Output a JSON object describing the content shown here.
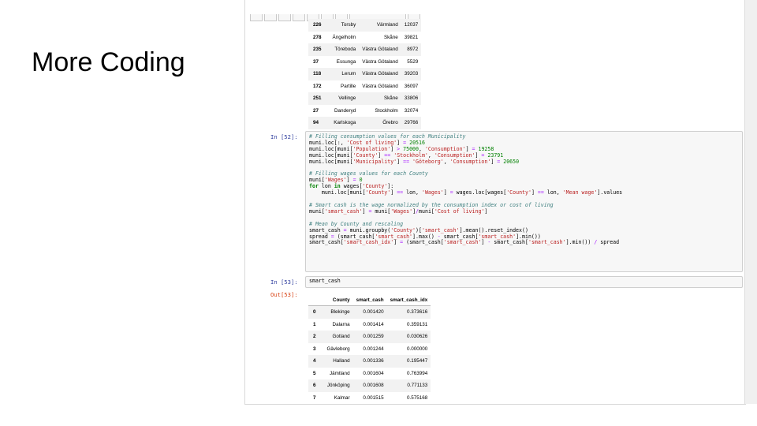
{
  "slide": {
    "title": "More Coding"
  },
  "table1": {
    "rows": [
      {
        "idx": "226",
        "municipality": "Torsby",
        "county": "Värmland",
        "value": "12037"
      },
      {
        "idx": "278",
        "municipality": "Ängelholm",
        "county": "Skåne",
        "value": "39821"
      },
      {
        "idx": "235",
        "municipality": "Töreboda",
        "county": "Västra Götaland",
        "value": "8972"
      },
      {
        "idx": "37",
        "municipality": "Essunga",
        "county": "Västra Götaland",
        "value": "5529"
      },
      {
        "idx": "118",
        "municipality": "Lerum",
        "county": "Västra Götaland",
        "value": "39203"
      },
      {
        "idx": "172",
        "municipality": "Partille",
        "county": "Västra Götaland",
        "value": "36097"
      },
      {
        "idx": "251",
        "municipality": "Vellinge",
        "county": "Skåne",
        "value": "33806"
      },
      {
        "idx": "27",
        "municipality": "Danderyd",
        "county": "Stockholm",
        "value": "32074"
      },
      {
        "idx": "94",
        "municipality": "Karlskoga",
        "county": "Örebro",
        "value": "29766"
      }
    ]
  },
  "cell52": {
    "prompt": "In [52]:",
    "lines": [
      [
        {
          "t": "# Filling consumption values for each Municipality",
          "c": "cm"
        }
      ],
      [
        {
          "t": "muni.loc[:, "
        },
        {
          "t": "'Cost of living'",
          "c": "st"
        },
        {
          "t": "] "
        },
        {
          "t": "=",
          "c": "op"
        },
        {
          "t": " "
        },
        {
          "t": "20516",
          "c": "nu"
        }
      ],
      [
        {
          "t": "muni.loc[muni["
        },
        {
          "t": "'Population'",
          "c": "st"
        },
        {
          "t": "] "
        },
        {
          "t": ">",
          "c": "op"
        },
        {
          "t": " "
        },
        {
          "t": "75000",
          "c": "nu"
        },
        {
          "t": ", "
        },
        {
          "t": "'Consumption'",
          "c": "st"
        },
        {
          "t": "] "
        },
        {
          "t": "=",
          "c": "op"
        },
        {
          "t": " "
        },
        {
          "t": "19258",
          "c": "nu"
        }
      ],
      [
        {
          "t": "muni.loc[muni["
        },
        {
          "t": "'County'",
          "c": "st"
        },
        {
          "t": "] "
        },
        {
          "t": "==",
          "c": "op"
        },
        {
          "t": " "
        },
        {
          "t": "'Stockholm'",
          "c": "st"
        },
        {
          "t": ", "
        },
        {
          "t": "'Consumption'",
          "c": "st"
        },
        {
          "t": "] "
        },
        {
          "t": "=",
          "c": "op"
        },
        {
          "t": " "
        },
        {
          "t": "23791",
          "c": "nu"
        }
      ],
      [
        {
          "t": "muni.loc[muni["
        },
        {
          "t": "'Municipality'",
          "c": "st"
        },
        {
          "t": "] "
        },
        {
          "t": "==",
          "c": "op"
        },
        {
          "t": " "
        },
        {
          "t": "'Göteborg'",
          "c": "st"
        },
        {
          "t": ", "
        },
        {
          "t": "'Consumption'",
          "c": "st"
        },
        {
          "t": "] "
        },
        {
          "t": "=",
          "c": "op"
        },
        {
          "t": " "
        },
        {
          "t": "20650",
          "c": "nu"
        }
      ],
      [],
      [
        {
          "t": "# Filling wages values for each County",
          "c": "cm"
        }
      ],
      [
        {
          "t": "muni["
        },
        {
          "t": "'Wages'",
          "c": "st"
        },
        {
          "t": "] "
        },
        {
          "t": "=",
          "c": "op"
        },
        {
          "t": " "
        },
        {
          "t": "0",
          "c": "nu"
        }
      ],
      [
        {
          "t": "for",
          "c": "kw"
        },
        {
          "t": " lon "
        },
        {
          "t": "in",
          "c": "kw"
        },
        {
          "t": " wages["
        },
        {
          "t": "'County'",
          "c": "st"
        },
        {
          "t": "]:"
        }
      ],
      [
        {
          "t": "    muni.loc[muni["
        },
        {
          "t": "'County'",
          "c": "st"
        },
        {
          "t": "] "
        },
        {
          "t": "==",
          "c": "op"
        },
        {
          "t": " lon, "
        },
        {
          "t": "'Wages'",
          "c": "st"
        },
        {
          "t": "] "
        },
        {
          "t": "=",
          "c": "op"
        },
        {
          "t": " wages.loc[wages["
        },
        {
          "t": "'County'",
          "c": "st"
        },
        {
          "t": "] "
        },
        {
          "t": "==",
          "c": "op"
        },
        {
          "t": " lon, "
        },
        {
          "t": "'Mean wage'",
          "c": "st"
        },
        {
          "t": "].values"
        }
      ],
      [],
      [
        {
          "t": "# Smart cash is the wage normalized by the consumption index or cost of living",
          "c": "cm"
        }
      ],
      [
        {
          "t": "muni["
        },
        {
          "t": "'smart_cash'",
          "c": "st"
        },
        {
          "t": "] "
        },
        {
          "t": "=",
          "c": "op"
        },
        {
          "t": " muni["
        },
        {
          "t": "'Wages'",
          "c": "st"
        },
        {
          "t": "]"
        },
        {
          "t": "/",
          "c": "op"
        },
        {
          "t": "muni["
        },
        {
          "t": "'Cost of living'",
          "c": "st"
        },
        {
          "t": "]"
        }
      ],
      [],
      [
        {
          "t": "# Mean by County and rescaling",
          "c": "cm"
        }
      ],
      [
        {
          "t": "smart_cash "
        },
        {
          "t": "=",
          "c": "op"
        },
        {
          "t": " muni.groupby("
        },
        {
          "t": "'County'",
          "c": "st"
        },
        {
          "t": ")["
        },
        {
          "t": "'smart_cash'",
          "c": "st"
        },
        {
          "t": "].mean().reset_index()"
        }
      ],
      [
        {
          "t": "spread "
        },
        {
          "t": "=",
          "c": "op"
        },
        {
          "t": " (smart_cash["
        },
        {
          "t": "'smart_cash'",
          "c": "st"
        },
        {
          "t": "].max() "
        },
        {
          "t": "-",
          "c": "op"
        },
        {
          "t": " smart_cash["
        },
        {
          "t": "'smart_cash'",
          "c": "st"
        },
        {
          "t": "].min())"
        }
      ],
      [
        {
          "t": "smart_cash["
        },
        {
          "t": "'smart_cash_idx'",
          "c": "st"
        },
        {
          "t": "] "
        },
        {
          "t": "=",
          "c": "op"
        },
        {
          "t": " (smart_cash["
        },
        {
          "t": "'smart_cash'",
          "c": "st"
        },
        {
          "t": "] "
        },
        {
          "t": "-",
          "c": "op"
        },
        {
          "t": " smart_cash["
        },
        {
          "t": "'smart_cash'",
          "c": "st"
        },
        {
          "t": "].min()) "
        },
        {
          "t": "/",
          "c": "op"
        },
        {
          "t": " spread"
        }
      ]
    ]
  },
  "cell53": {
    "prompt": "In [53]:",
    "code": "smart_cash",
    "out_prompt": "Out[53]:"
  },
  "table2": {
    "headers": [
      "",
      "County",
      "smart_cash",
      "smart_cash_idx"
    ],
    "rows": [
      {
        "idx": "0",
        "county": "Blekinge",
        "smart_cash": "0.001420",
        "idx_val": "0.373616"
      },
      {
        "idx": "1",
        "county": "Dalarna",
        "smart_cash": "0.001414",
        "idx_val": "0.359131"
      },
      {
        "idx": "2",
        "county": "Gotland",
        "smart_cash": "0.001259",
        "idx_val": "0.030626"
      },
      {
        "idx": "3",
        "county": "Gävleborg",
        "smart_cash": "0.001244",
        "idx_val": "0.000000"
      },
      {
        "idx": "4",
        "county": "Halland",
        "smart_cash": "0.001336",
        "idx_val": "0.195447"
      },
      {
        "idx": "5",
        "county": "Jämtland",
        "smart_cash": "0.001604",
        "idx_val": "0.763994"
      },
      {
        "idx": "6",
        "county": "Jönköping",
        "smart_cash": "0.001608",
        "idx_val": "0.771133"
      },
      {
        "idx": "7",
        "county": "Kalmar",
        "smart_cash": "0.001515",
        "idx_val": "0.575168"
      }
    ]
  }
}
